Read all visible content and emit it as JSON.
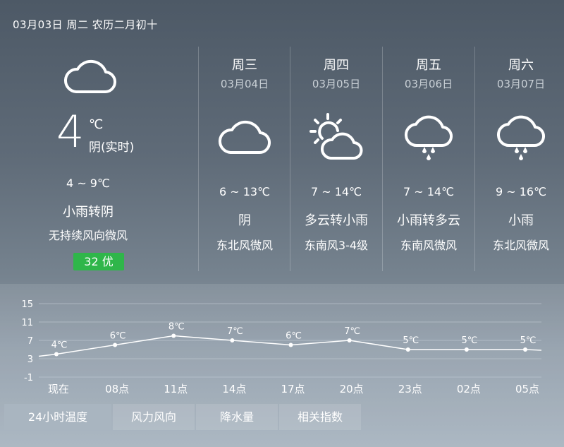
{
  "header": {
    "date_line": "03月03日 周二 农历二月初十"
  },
  "today": {
    "icon": "cloud-icon",
    "temp": "4",
    "unit": "℃",
    "desc": "阴(实时)",
    "range": "4 ~ 9℃",
    "weather": "小雨转阴",
    "wind": "无持续风向微风",
    "aqi": "32  优"
  },
  "forecast": [
    {
      "weekday": "周三",
      "date": "03月04日",
      "icon": "cloud-icon",
      "range": "6 ~ 13℃",
      "weather": "阴",
      "wind": "东北风微风"
    },
    {
      "weekday": "周四",
      "date": "03月05日",
      "icon": "sun-cloud-icon",
      "range": "7 ~ 14℃",
      "weather": "多云转小雨",
      "wind": "东南风3-4级"
    },
    {
      "weekday": "周五",
      "date": "03月06日",
      "icon": "rain-cloud-icon",
      "range": "7 ~ 14℃",
      "weather": "小雨转多云",
      "wind": "东南风微风"
    },
    {
      "weekday": "周六",
      "date": "03月07日",
      "icon": "rain-cloud-icon",
      "range": "9 ~ 16℃",
      "weather": "小雨",
      "wind": "东北风微风"
    }
  ],
  "chart_data": {
    "type": "line",
    "categories": [
      "现在",
      "08点",
      "11点",
      "14点",
      "17点",
      "20点",
      "23点",
      "02点",
      "05点"
    ],
    "series": [
      {
        "values": [
          4,
          6,
          8,
          7,
          6,
          7,
          5,
          5,
          5
        ],
        "labels": [
          "4℃",
          "6℃",
          "8℃",
          "7℃",
          "6℃",
          "7℃",
          "5℃",
          "5℃",
          "5℃"
        ]
      }
    ],
    "yticks": [
      15,
      11,
      7,
      3,
      -1
    ],
    "ylim": [
      -1,
      15
    ],
    "grid": true,
    "colors": {
      "line": "#ffffff",
      "grid": "#c7d0d8"
    }
  },
  "tabs": [
    {
      "label": "24小时温度",
      "active": true
    },
    {
      "label": "风力风向",
      "active": false
    },
    {
      "label": "降水量",
      "active": false
    },
    {
      "label": "相关指数",
      "active": false
    }
  ],
  "colors": {
    "aqi_good": "#2fb64a"
  }
}
